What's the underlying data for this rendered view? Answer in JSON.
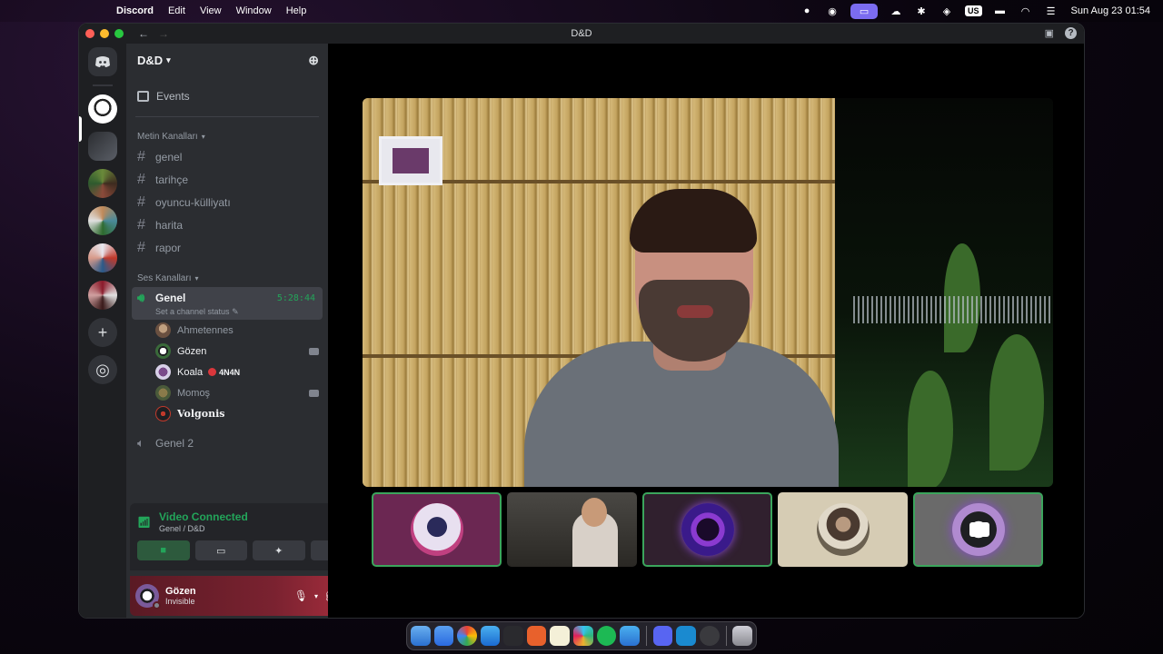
{
  "menubar": {
    "app_name": "Discord",
    "menus": [
      "Edit",
      "View",
      "Window",
      "Help"
    ],
    "input_source": "US",
    "clock": "Sun Aug 23  01:54"
  },
  "window": {
    "title": "D&D"
  },
  "guild": {
    "name": "D&D",
    "events_label": "Events",
    "text_category": "Metin Kanalları",
    "text_channels": [
      "genel",
      "tarihçe",
      "oyuncu-külliyatı",
      "harita",
      "rapor"
    ],
    "voice_category": "Ses Kanalları",
    "active_voice": {
      "name": "Genel",
      "timer": "5:28:44",
      "status_placeholder": "Set a channel status"
    },
    "voice_users": [
      {
        "name": "Ahmetennes",
        "camera": false,
        "badge": ""
      },
      {
        "name": "Gözen",
        "camera": true,
        "badge": ""
      },
      {
        "name": "Koala",
        "camera": false,
        "badge": "4N4N"
      },
      {
        "name": "Momoş",
        "camera": true,
        "badge": ""
      },
      {
        "name": "Volgonis",
        "camera": false,
        "badge": ""
      }
    ],
    "other_voice": "Genel 2"
  },
  "rtc_panel": {
    "title": "Video Connected",
    "subtitle": "Genel / D&D"
  },
  "user_panel": {
    "name": "Gözen",
    "status": "Invisible"
  },
  "colors": {
    "accent_green": "#23a55a",
    "sidebar_bg": "#2b2d31",
    "rail_bg": "#1e1f22"
  }
}
